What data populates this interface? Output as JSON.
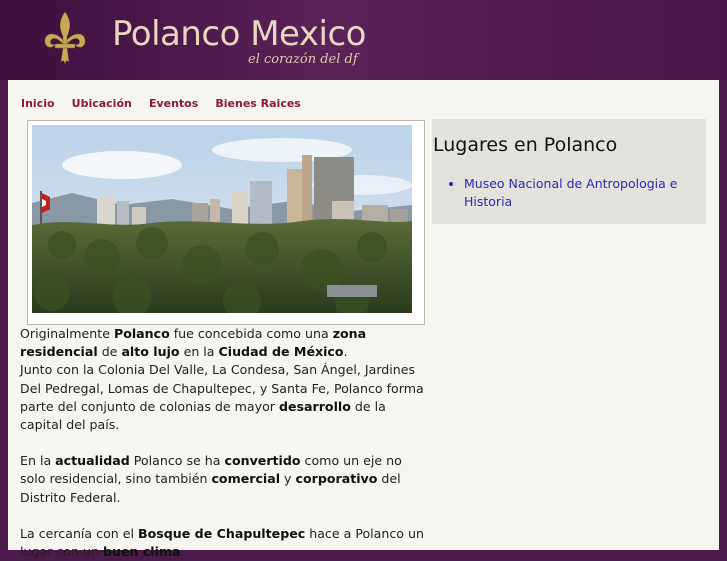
{
  "header": {
    "title": "Polanco Mexico",
    "tagline": "el corazón del df"
  },
  "nav": {
    "items": [
      "Inicio",
      "Ubicación",
      "Eventos",
      "Bienes Raices"
    ]
  },
  "main": {
    "photo_alt": "Polanco skyline",
    "p1": {
      "t1": "Originalmente ",
      "b1": "Polanco",
      "t2": " fue concebida como una ",
      "b2": "zona residencial",
      "t3": " de ",
      "b3": "alto lujo",
      "t4": " en la ",
      "b4": "Ciudad de México",
      "t5": ".",
      "t6": "Junto con la Colonia Del Valle, La Condesa, San Ángel, Jardines Del Pedregal, Lomas de Chapultepec, y Santa Fe, Polanco forma parte del conjunto de colonias de mayor ",
      "b5": "desarrollo",
      "t7": " de la capital del país."
    },
    "p2": {
      "t1": "En la ",
      "b1": "actualidad",
      "t2": " Polanco se ha ",
      "b2": "convertido",
      "t3": " como un eje no solo residencial, sino también ",
      "b3": "comercial",
      "t4": " y ",
      "b4": "corporativo",
      "t5": " del Distrito Federal."
    },
    "p3": {
      "t1": "La cercanía con el ",
      "b1": "Bosque de Chapultepec",
      "t2": " hace a Polanco un lugar con un ",
      "b2": "buen clima",
      "t3": "."
    }
  },
  "sidebar": {
    "title": "Lugares en Polanco",
    "links": [
      "Museo Nacional de Antropologia e Historia"
    ]
  },
  "colors": {
    "header_bg": "#4a1648",
    "nav_link": "#8a1a3a",
    "sidebar_link": "#2a2ab0"
  }
}
